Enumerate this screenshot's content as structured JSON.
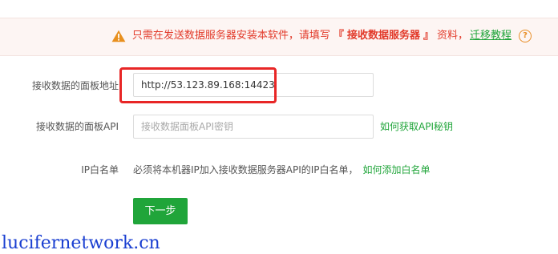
{
  "notice": {
    "text_part1": "只需在发送数据服务器安装本软件，请填写",
    "bracket_open": "『",
    "highlight": "接收数据服务器",
    "bracket_close": "』",
    "text_part2": "资料，",
    "link": "迁移教程",
    "warning_icon": "warning-triangle-icon",
    "help_icon": "question-circle-icon",
    "help_glyph": "?"
  },
  "form": {
    "panel_address": {
      "label": "接收数据的面板地址",
      "value": "http://53.123.89.168:14423"
    },
    "panel_api": {
      "label": "接收数据的面板API",
      "placeholder": "接收数据面板API密钥",
      "help_link": "如何获取API秘钥"
    },
    "ip_whitelist": {
      "label": "IP白名单",
      "text": "必须将本机器IP加入接收数据服务器API的IP白名单，",
      "help_link": "如何添加白名单"
    },
    "next_button": "下一步"
  },
  "watermark": "lucifernetwork.cn",
  "colors": {
    "accent_green": "#20a53a",
    "warning_red": "#e23b2b",
    "highlight_border": "#e82626",
    "watermark_blue": "#1a3fd1",
    "warning_icon_orange": "#e8901f"
  }
}
